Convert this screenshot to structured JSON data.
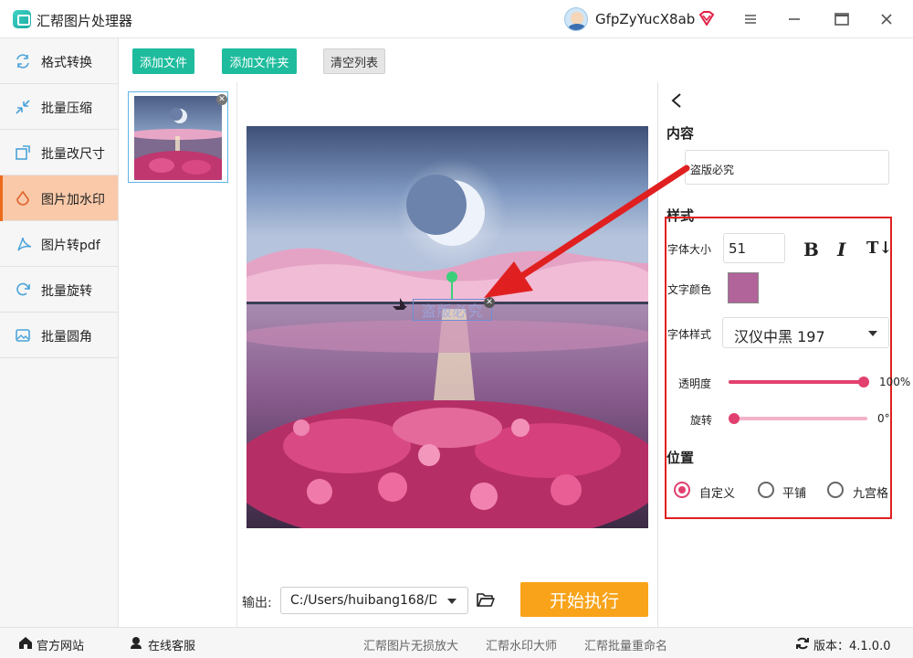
{
  "app": {
    "title": "汇帮图片处理器"
  },
  "user": {
    "name": "GfpZyYucX8ab"
  },
  "sidebar": {
    "items": [
      {
        "label": "格式转换",
        "icon": "format-convert-icon"
      },
      {
        "label": "批量压缩",
        "icon": "compress-icon"
      },
      {
        "label": "批量改尺寸",
        "icon": "resize-icon"
      },
      {
        "label": "图片加水印",
        "icon": "watermark-icon",
        "active": true
      },
      {
        "label": "图片转pdf",
        "icon": "pdf-icon"
      },
      {
        "label": "批量旋转",
        "icon": "rotate-icon"
      },
      {
        "label": "批量圆角",
        "icon": "rounded-corner-icon"
      }
    ]
  },
  "toolbar": {
    "add_file": "添加文件",
    "add_folder": "添加文件夹",
    "clear_list": "清空列表"
  },
  "watermark_preview": {
    "text": "盗版必究"
  },
  "output": {
    "label": "输出:",
    "path": "C:/Users/huibang168/D",
    "start": "开始执行"
  },
  "panel": {
    "content_title": "内容",
    "content_value": "盗版必究",
    "style_title": "样式",
    "font_size_label": "字体大小",
    "font_size_value": "51",
    "bold": "B",
    "italic": "I",
    "text_tool": "T↓",
    "color_label": "文字颜色",
    "color_value": "#b0649a",
    "font_style_label": "字体样式",
    "font_style_value": "汉仪中黑 197",
    "opacity_label": "透明度",
    "opacity_value": "100%",
    "opacity_fraction": 1.0,
    "rotate_label": "旋转",
    "rotate_value": "0°",
    "rotate_fraction": 0.0,
    "position_title": "位置",
    "position_options": [
      {
        "label": "自定义",
        "selected": true
      },
      {
        "label": "平铺",
        "selected": false
      },
      {
        "label": "九宫格",
        "selected": false
      }
    ]
  },
  "footer": {
    "website": "官方网站",
    "support": "在线客服",
    "links": [
      "汇帮图片无损放大",
      "汇帮水印大师",
      "汇帮批量重命名"
    ],
    "version": "版本：4.1.0.0"
  },
  "colors": {
    "accent_green": "#1ebc9d",
    "accent_orange": "#f8a31a",
    "active_sidebar": "#f9c9a9",
    "slider_pink": "#e2406e",
    "annotation_red": "#e02020"
  }
}
